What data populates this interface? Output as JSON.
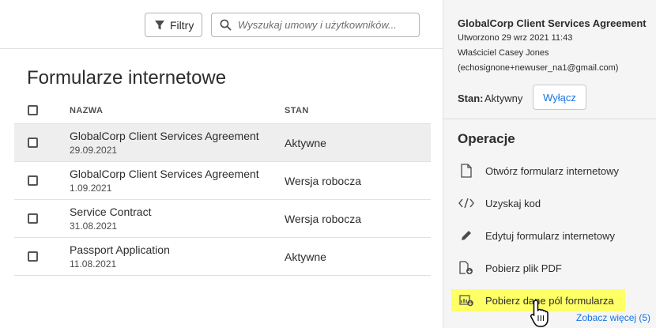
{
  "toolbar": {
    "filter_label": "Filtry",
    "search_placeholder": "Wyszukaj umowy i użytkowników..."
  },
  "main": {
    "title": "Formularze internetowe",
    "columns": {
      "name": "NAZWA",
      "status": "STAN"
    },
    "rows": [
      {
        "name": "GlobalCorp Client Services Agreement",
        "date": "29.09.2021",
        "status": "Aktywne",
        "selected": true
      },
      {
        "name": "GlobalCorp Client Services Agreement",
        "date": "1.09.2021",
        "status": "Wersja robocza",
        "selected": false
      },
      {
        "name": "Service Contract",
        "date": "31.08.2021",
        "status": "Wersja robocza",
        "selected": false
      },
      {
        "name": "Passport Application",
        "date": "11.08.2021",
        "status": "Aktywne",
        "selected": false
      }
    ]
  },
  "panel": {
    "title": "GlobalCorp Client Services Agreement",
    "created": "Utworzono 29 wrz 2021 11:43",
    "owner": "Właściciel Casey Jones",
    "email": "(echosignone+newuser_na1@gmail.com)",
    "state_label": "Stan:",
    "state_value": "Aktywny",
    "disable_label": "Wyłącz",
    "operations_title": "Operacje",
    "operations": [
      {
        "label": "Otwórz formularz internetowy",
        "icon": "document-icon"
      },
      {
        "label": "Uzyskaj kod",
        "icon": "code-icon"
      },
      {
        "label": "Edytuj formularz internetowy",
        "icon": "pencil-icon"
      },
      {
        "label": "Pobierz plik PDF",
        "icon": "pdf-download-icon"
      },
      {
        "label": "Pobierz dane pól formularza",
        "icon": "chart-download-icon",
        "highlighted": true
      }
    ],
    "see_more": "Zobacz więcej (5)"
  },
  "colors": {
    "accent": "#1473e6",
    "highlight": "#ffff66",
    "selected_row": "#eeeeee",
    "panel_bg": "#f5f5f5"
  }
}
